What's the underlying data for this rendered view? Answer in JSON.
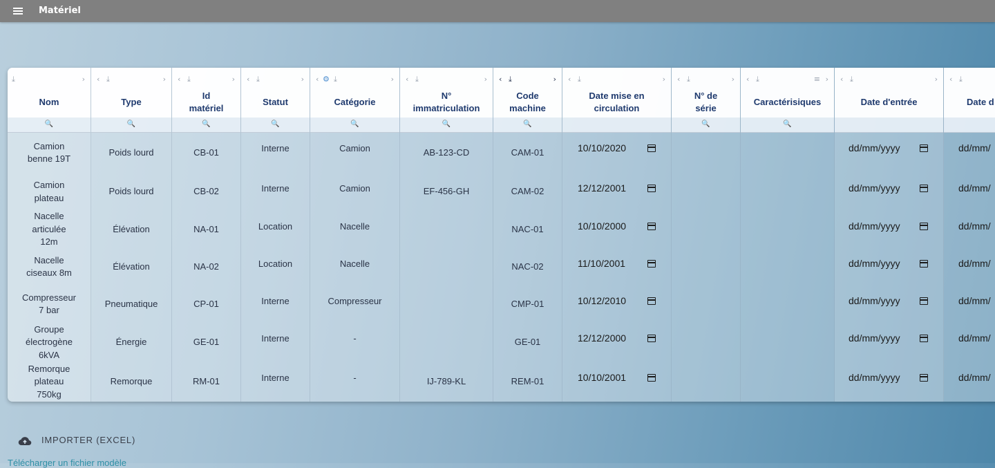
{
  "app": {
    "title": "Matériel",
    "menu_icon": "menu-icon"
  },
  "columns": [
    {
      "key": "nom",
      "label": "Nom"
    },
    {
      "key": "type",
      "label": "Type"
    },
    {
      "key": "id",
      "label": "Id matériel"
    },
    {
      "key": "statut",
      "label": "Statut"
    },
    {
      "key": "categorie",
      "label": "Catégorie"
    },
    {
      "key": "immat",
      "label": "N° immatriculation"
    },
    {
      "key": "code",
      "label": "Code machine"
    },
    {
      "key": "date_circ",
      "label": "Date mise en circulation"
    },
    {
      "key": "serie",
      "label": "N° de série"
    },
    {
      "key": "caract",
      "label": "Caractérisiques"
    },
    {
      "key": "date_entree",
      "label": "Date d'entrée"
    },
    {
      "key": "date_sortie",
      "label": "Date d"
    }
  ],
  "rows": [
    {
      "nom": "Camion benne 19T",
      "type": "Poids lourd",
      "id": "CB-01",
      "statut": "Interne",
      "categorie": "Camion",
      "immat": "AB-123-CD",
      "code": "CAM-01",
      "date_circ": "10/10/2020",
      "serie": "",
      "caract": "",
      "date_entree": "dd/mm/yyyy",
      "date_sortie": "dd/mm/"
    },
    {
      "nom": "Camion plateau",
      "type": "Poids lourd",
      "id": "CB-02",
      "statut": "Interne",
      "categorie": "Camion",
      "immat": "EF-456-GH",
      "code": "CAM-02",
      "date_circ": "12/12/2001",
      "serie": "",
      "caract": "",
      "date_entree": "dd/mm/yyyy",
      "date_sortie": "dd/mm/"
    },
    {
      "nom": "Nacelle articulée 12m",
      "type": "Élévation",
      "id": "NA-01",
      "statut": "Location",
      "categorie": "Nacelle",
      "immat": "",
      "code": "NAC-01",
      "date_circ": "10/10/2000",
      "serie": "",
      "caract": "",
      "date_entree": "dd/mm/yyyy",
      "date_sortie": "dd/mm/"
    },
    {
      "nom": "Nacelle ciseaux 8m",
      "type": "Élévation",
      "id": "NA-02",
      "statut": "Location",
      "categorie": "Nacelle",
      "immat": "",
      "code": "NAC-02",
      "date_circ": "11/10/2001",
      "serie": "",
      "caract": "",
      "date_entree": "dd/mm/yyyy",
      "date_sortie": "dd/mm/"
    },
    {
      "nom": "Compresseur 7 bar",
      "type": "Pneumatique",
      "id": "CP-01",
      "statut": "Interne",
      "categorie": "Compresseur",
      "immat": "",
      "code": "CMP-01",
      "date_circ": "10/12/2010",
      "serie": "",
      "caract": "",
      "date_entree": "dd/mm/yyyy",
      "date_sortie": "dd/mm/"
    },
    {
      "nom": "Groupe électrogène 6kVA",
      "type": "Énergie",
      "id": "GE-01",
      "statut": "Interne",
      "categorie": "-",
      "immat": "",
      "code": "GE-01",
      "date_circ": "12/12/2000",
      "serie": "",
      "caract": "",
      "date_entree": "dd/mm/yyyy",
      "date_sortie": "dd/mm/"
    },
    {
      "nom": "Remorque plateau 750kg",
      "type": "Remorque",
      "id": "RM-01",
      "statut": "Interne",
      "categorie": "-",
      "immat": "IJ-789-KL",
      "code": "REM-01",
      "date_circ": "10/10/2001",
      "serie": "",
      "caract": "",
      "date_entree": "dd/mm/yyyy",
      "date_sortie": "dd/mm/"
    }
  ],
  "import_button": {
    "label": "IMPORTER (EXCEL)",
    "icon": "cloud-upload-icon"
  },
  "footer_link": "Télécharger un fichier modèle",
  "colors": {
    "topbar": "#808080",
    "header_text": "#1f3a6e",
    "link": "#2f8fa6"
  }
}
